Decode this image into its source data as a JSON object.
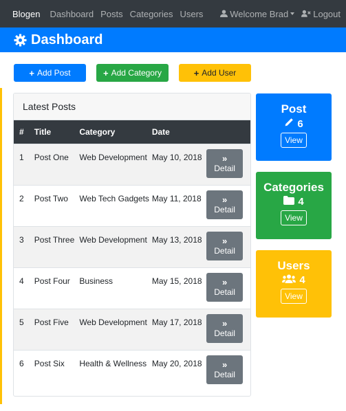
{
  "nav": {
    "brand": "Blogen",
    "links": [
      "Dashboard",
      "Posts",
      "Categories",
      "Users"
    ],
    "welcome": "Welcome Brad",
    "logout": "Logout"
  },
  "header": {
    "title": "Dashboard",
    "icon": "gear-icon"
  },
  "actions": {
    "add_post": "Add Post",
    "add_category": "Add Category",
    "add_user": "Add User"
  },
  "latest_posts": {
    "title": "Latest Posts",
    "columns": [
      "#",
      "Title",
      "Category",
      "Date"
    ],
    "detail_label": "Detail",
    "rows": [
      {
        "num": "1",
        "title": "Post One",
        "category": "Web Development",
        "date": "May 10, 2018"
      },
      {
        "num": "2",
        "title": "Post Two",
        "category": "Web Tech Gadgets",
        "date": "May 11, 2018"
      },
      {
        "num": "3",
        "title": "Post Three",
        "category": "Web Development",
        "date": "May 13, 2018"
      },
      {
        "num": "4",
        "title": "Post Four",
        "category": "Business",
        "date": "May 15, 2018"
      },
      {
        "num": "5",
        "title": "Post Five",
        "category": "Web Development",
        "date": "May 17, 2018"
      },
      {
        "num": "6",
        "title": "Post Six",
        "category": "Health & Wellness",
        "date": "May 20, 2018"
      }
    ]
  },
  "stats": {
    "posts": {
      "title": "Post",
      "count": "6",
      "view": "View",
      "icon": "pencil-icon"
    },
    "categories": {
      "title": "Categories",
      "count": "4",
      "view": "View",
      "icon": "folder-icon"
    },
    "users": {
      "title": "Users",
      "count": "4",
      "view": "View",
      "icon": "users-icon"
    }
  },
  "colors": {
    "primary": "#007bff",
    "success": "#28a745",
    "warning": "#ffc107",
    "dark": "#343a40",
    "secondary": "#6c757d"
  }
}
